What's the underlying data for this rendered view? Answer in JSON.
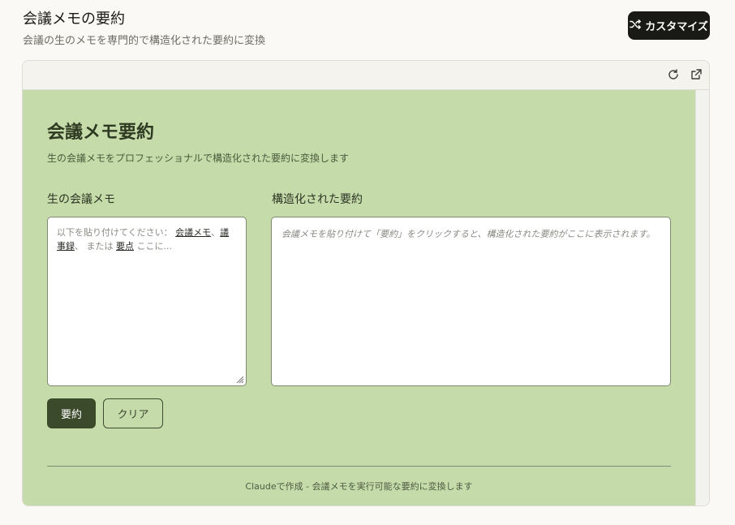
{
  "header": {
    "title": "会議メモの要約",
    "subtitle": "会議の生のメモを専門的で構造化された要約に変換",
    "customize_label": "カスタマイズ",
    "customize_icon": "shuffle-icon"
  },
  "toolbar": {
    "refresh_icon": "refresh-icon",
    "external_icon": "external-link-icon"
  },
  "app": {
    "title": "会議メモ要約",
    "subtitle": "生の会議メモをプロフェッショナルで構造化された要約に変換します",
    "input_label": "生の会議メモ",
    "placeholder_prefix": "以下を貼り付けてください：",
    "placeholder_kw1": "会議メモ",
    "placeholder_sep": "、",
    "placeholder_kw2": "議事録",
    "placeholder_sep2": "、",
    "placeholder_or": "または",
    "placeholder_kw3": "要点",
    "placeholder_suffix": "ここに...",
    "output_label": "構造化された要約",
    "output_placeholder": "会議メモを貼り付けて「要約」をクリックすると、構造化された要約がここに表示されます。",
    "summarize_label": "要約",
    "clear_label": "クリア",
    "footer": "Claudeで作成 - 会議メモを実行可能な要約に変換します"
  },
  "colors": {
    "app_background": "#c5dcaa",
    "primary_button": "#3a4a2a",
    "customize_button": "#191915"
  }
}
